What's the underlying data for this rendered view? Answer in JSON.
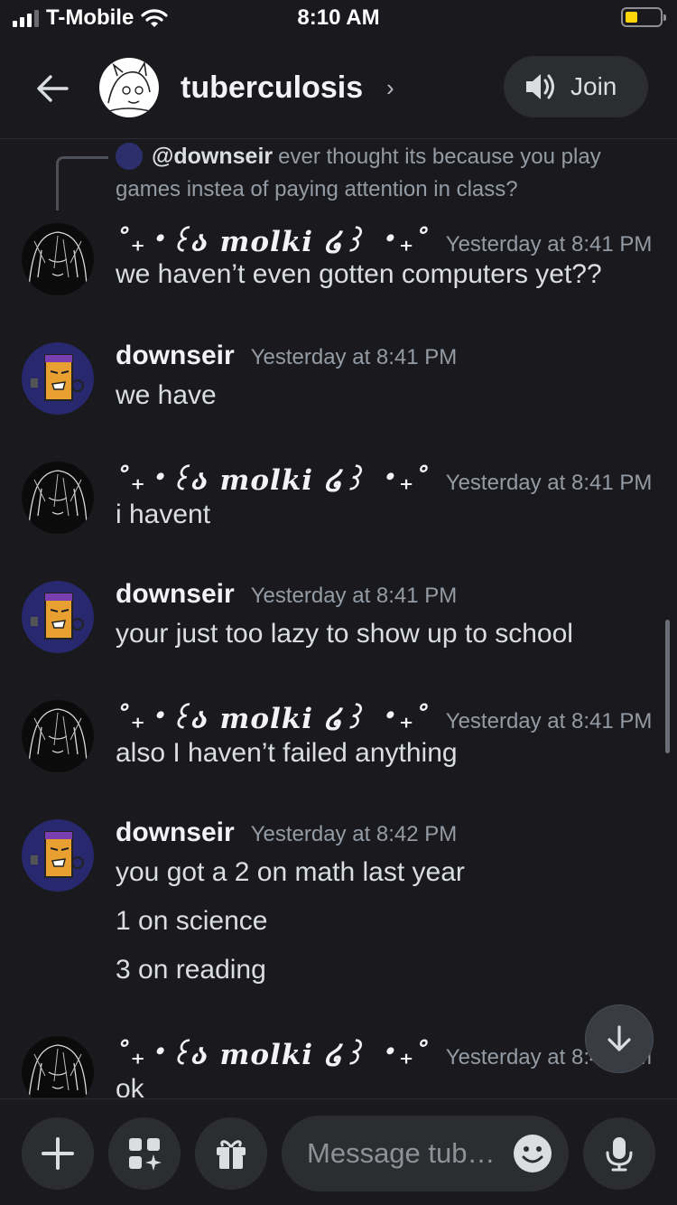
{
  "status_bar": {
    "carrier": "T-Mobile",
    "time": "8:10 AM"
  },
  "header": {
    "channel_name": "tuberculosis",
    "chevron": "›",
    "join_label": "Join"
  },
  "reply": {
    "mention": "@downseir",
    "text": "ever thought its because you play games instea of paying attention in class?"
  },
  "messages": [
    {
      "author": "˚₊‧꒰ა 𝒎𝒐𝒍𝒌𝒊 ໒꒱ ‧₊˚",
      "timestamp": "Yesterday at 8:41 PM",
      "avatar": "molki-avatar",
      "lines": [
        "we haven’t even gotten computers yet??"
      ]
    },
    {
      "author": "downseir",
      "timestamp": "Yesterday at 8:41 PM",
      "avatar": "downseir-avatar",
      "lines": [
        "we have"
      ]
    },
    {
      "author": "˚₊‧꒰ა 𝒎𝒐𝒍𝒌𝒊 ໒꒱ ‧₊˚",
      "timestamp": "Yesterday at 8:41 PM",
      "avatar": "molki-avatar",
      "lines": [
        "i havent"
      ]
    },
    {
      "author": "downseir",
      "timestamp": "Yesterday at 8:41 PM",
      "avatar": "downseir-avatar",
      "lines": [
        "your just too lazy to show up to school"
      ]
    },
    {
      "author": "˚₊‧꒰ა 𝒎𝒐𝒍𝒌𝒊 ໒꒱ ‧₊˚",
      "timestamp": "Yesterday at 8:41 PM",
      "avatar": "molki-avatar",
      "lines": [
        "also I haven’t failed anything"
      ]
    },
    {
      "author": "downseir",
      "timestamp": "Yesterday at 8:42 PM",
      "avatar": "downseir-avatar",
      "lines": [
        "you got a 2 on math last year",
        "1 on science",
        "3 on reading"
      ]
    },
    {
      "author": "˚₊‧꒰ა 𝒎𝒐𝒍𝒌𝒊 ໒꒱ ‧₊˚",
      "timestamp": "Yesterday at 8:42 PM",
      "avatar": "molki-avatar",
      "lines": [
        "ok"
      ]
    }
  ],
  "composer": {
    "placeholder": "Message tub…"
  },
  "icons": [
    "back-arrow-icon",
    "speaker-icon",
    "plus-icon",
    "apps-icon",
    "gift-icon",
    "emoji-icon",
    "microphone-icon",
    "arrow-down-icon",
    "signal-icon",
    "wifi-icon",
    "battery-icon"
  ],
  "colors": {
    "background": "#1a1a1e",
    "surface": "#2b2d31",
    "battery": "#ffd60a",
    "text": "#dbdee1",
    "muted": "#949ba4"
  }
}
